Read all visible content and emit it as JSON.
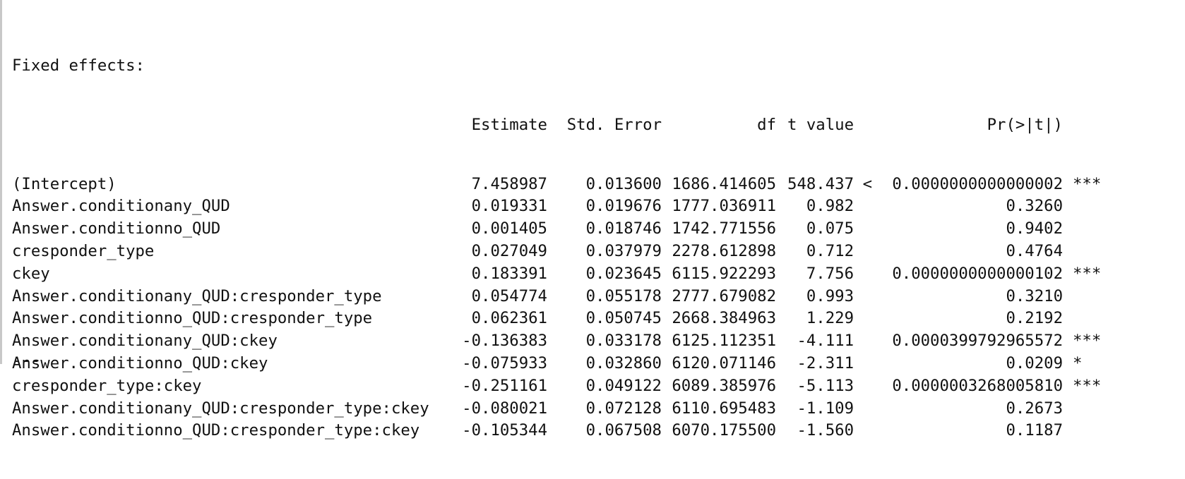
{
  "section_title": "Fixed effects:",
  "headers": {
    "estimate": "Estimate",
    "std_error": "Std. Error",
    "df": "df",
    "t_value": "t value",
    "p_value": "Pr(>|t|)"
  },
  "rows": [
    {
      "name": "(Intercept)",
      "estimate": "7.458987",
      "std_error": "0.013600",
      "df": "1686.414605",
      "t_value": "548.437",
      "lt": "<",
      "p_value": "0.0000000000000002",
      "sig": "***"
    },
    {
      "name": "Answer.conditionany_QUD",
      "estimate": "0.019331",
      "std_error": "0.019676",
      "df": "1777.036911",
      "t_value": "0.982",
      "lt": "",
      "p_value": "0.3260",
      "sig": ""
    },
    {
      "name": "Answer.conditionno_QUD",
      "estimate": "0.001405",
      "std_error": "0.018746",
      "df": "1742.771556",
      "t_value": "0.075",
      "lt": "",
      "p_value": "0.9402",
      "sig": ""
    },
    {
      "name": "cresponder_type",
      "estimate": "0.027049",
      "std_error": "0.037979",
      "df": "2278.612898",
      "t_value": "0.712",
      "lt": "",
      "p_value": "0.4764",
      "sig": ""
    },
    {
      "name": "ckey",
      "estimate": "0.183391",
      "std_error": "0.023645",
      "df": "6115.922293",
      "t_value": "7.756",
      "lt": "",
      "p_value": "0.0000000000000102",
      "sig": "***"
    },
    {
      "name": "Answer.conditionany_QUD:cresponder_type",
      "estimate": "0.054774",
      "std_error": "0.055178",
      "df": "2777.679082",
      "t_value": "0.993",
      "lt": "",
      "p_value": "0.3210",
      "sig": ""
    },
    {
      "name": "Answer.conditionno_QUD:cresponder_type",
      "estimate": "0.062361",
      "std_error": "0.050745",
      "df": "2668.384963",
      "t_value": "1.229",
      "lt": "",
      "p_value": "0.2192",
      "sig": ""
    },
    {
      "name": "Answer.conditionany_QUD:ckey",
      "estimate": "-0.136383",
      "std_error": "0.033178",
      "df": "6125.112351",
      "t_value": "-4.111",
      "lt": "",
      "p_value": "0.0000399792965572",
      "sig": "***"
    },
    {
      "name": "Answer.conditionno_QUD:ckey",
      "estimate": "-0.075933",
      "std_error": "0.032860",
      "df": "6120.071146",
      "t_value": "-2.311",
      "lt": "",
      "p_value": "0.0209",
      "sig": "*"
    },
    {
      "name": "cresponder_type:ckey",
      "estimate": "-0.251161",
      "std_error": "0.049122",
      "df": "6089.385976",
      "t_value": "-5.113",
      "lt": "",
      "p_value": "0.0000003268005810",
      "sig": "***"
    },
    {
      "name": "Answer.conditionany_QUD:cresponder_type:ckey",
      "estimate": "-0.080021",
      "std_error": "0.072128",
      "df": "6110.695483",
      "t_value": "-1.109",
      "lt": "",
      "p_value": "0.2673",
      "sig": ""
    },
    {
      "name": "Answer.conditionno_QUD:cresponder_type:ckey",
      "estimate": "-0.105344",
      "std_error": "0.067508",
      "df": "6070.175500",
      "t_value": "-1.560",
      "lt": "",
      "p_value": "0.1187",
      "sig": ""
    }
  ],
  "footer_text": "---"
}
